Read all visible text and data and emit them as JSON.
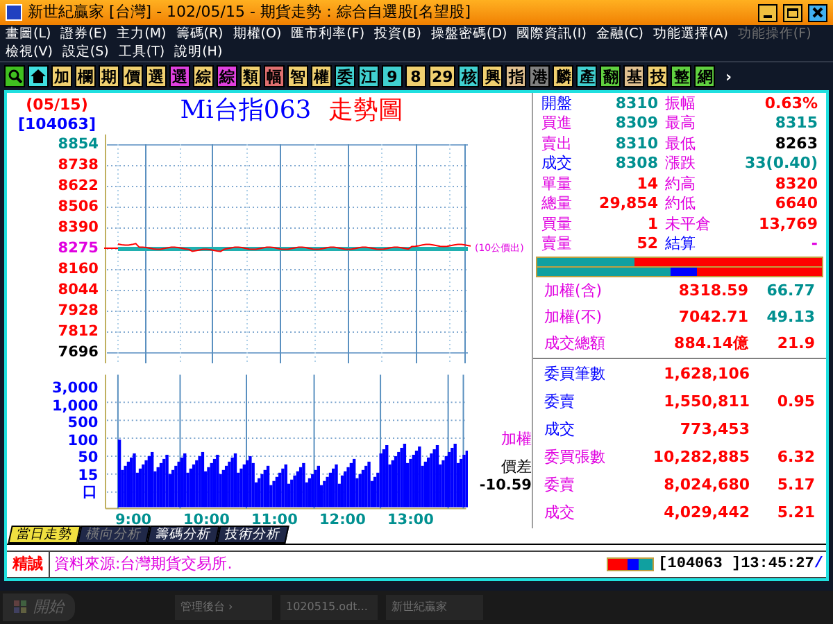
{
  "window": {
    "title": "新世紀贏家 [台灣]  - 102/05/15 - 期貨走勢：綜合自選股[名望股]"
  },
  "menu": [
    [
      {
        "label": "畫圖(L)",
        "disabled": false
      },
      {
        "label": "證券(E)",
        "disabled": false
      },
      {
        "label": "主力(M)",
        "disabled": false
      },
      {
        "label": "籌碼(R)",
        "disabled": false
      },
      {
        "label": "期權(O)",
        "disabled": false
      },
      {
        "label": "匯市利率(F)",
        "disabled": false
      },
      {
        "label": "投資(B)",
        "disabled": false
      },
      {
        "label": "操盤密碼(D)",
        "disabled": false
      },
      {
        "label": "國際資訊(I)",
        "disabled": false
      },
      {
        "label": "金融(C)",
        "disabled": false
      },
      {
        "label": "功能選擇(A)",
        "disabled": false
      },
      {
        "label": "功能操作(F)",
        "disabled": true
      }
    ],
    [
      {
        "label": "檢視(V)",
        "disabled": false
      },
      {
        "label": "設定(S)",
        "disabled": false
      },
      {
        "label": "工具(T)",
        "disabled": false
      },
      {
        "label": "說明(H)",
        "disabled": false
      }
    ]
  ],
  "toolbar": [
    {
      "kind": "search",
      "color": "#40c020"
    },
    {
      "kind": "home",
      "color": "#40e0e0"
    },
    {
      "kind": "text",
      "label": "加",
      "color": "#f0d070"
    },
    {
      "kind": "text",
      "label": "欄",
      "color": "#f0d070"
    },
    {
      "kind": "text",
      "label": "期",
      "color": "#f0d070"
    },
    {
      "kind": "text",
      "label": "價",
      "color": "#f0d070"
    },
    {
      "kind": "text",
      "label": "選",
      "color": "#f0d070"
    },
    {
      "kind": "text",
      "label": "選",
      "color": "#e040e0"
    },
    {
      "kind": "text",
      "label": "綜",
      "color": "#f0d070"
    },
    {
      "kind": "text",
      "label": "綜",
      "color": "#e040e0"
    },
    {
      "kind": "text",
      "label": "類",
      "color": "#f0d070"
    },
    {
      "kind": "text",
      "label": "幅",
      "color": "#e07070"
    },
    {
      "kind": "text",
      "label": "智",
      "color": "#f0d070"
    },
    {
      "kind": "text",
      "label": "權",
      "color": "#f0d070"
    },
    {
      "kind": "text",
      "label": "委",
      "color": "#40d0d0"
    },
    {
      "kind": "text",
      "label": "江",
      "color": "#40d0d0"
    },
    {
      "kind": "text",
      "label": "9",
      "color": "#40d0d0"
    },
    {
      "kind": "text",
      "label": "8",
      "color": "#f0d070"
    },
    {
      "kind": "text",
      "label": "29",
      "color": "#f0d070"
    },
    {
      "kind": "text",
      "label": "核",
      "color": "#40d0d0"
    },
    {
      "kind": "text",
      "label": "興",
      "color": "#f0d070"
    },
    {
      "kind": "text",
      "label": "指",
      "color": "#e0c090"
    },
    {
      "kind": "text",
      "label": "港",
      "color": "#808080"
    },
    {
      "kind": "text",
      "label": "麟",
      "color": "#f0d070"
    },
    {
      "kind": "text",
      "label": "產",
      "color": "#40d0d0"
    },
    {
      "kind": "text",
      "label": "翻",
      "color": "#60d040"
    },
    {
      "kind": "text",
      "label": "基",
      "color": "#e0c090"
    },
    {
      "kind": "text",
      "label": "技",
      "color": "#f0d070"
    },
    {
      "kind": "text",
      "label": "整",
      "color": "#60d040"
    },
    {
      "kind": "text",
      "label": "網",
      "color": "#60d040"
    },
    {
      "kind": "text",
      "label": "›",
      "color": "#101828"
    }
  ],
  "chart": {
    "date": "(05/15)",
    "code": "[104063]",
    "title": "Mi台指063",
    "title_suffix": "走勢圖",
    "price_ticks": [
      {
        "label": "8854",
        "color": "#009090"
      },
      {
        "label": "8738",
        "color": "#ff0000"
      },
      {
        "label": "8622",
        "color": "#ff0000"
      },
      {
        "label": "8506",
        "color": "#ff0000"
      },
      {
        "label": "8390",
        "color": "#ff0000"
      },
      {
        "label": "8275",
        "color": "#e000e0"
      },
      {
        "label": "8160",
        "color": "#ff0000"
      },
      {
        "label": "8044",
        "color": "#ff0000"
      },
      {
        "label": "7928",
        "color": "#ff0000"
      },
      {
        "label": "7812",
        "color": "#ff0000"
      },
      {
        "label": "7696",
        "color": "#000000"
      }
    ],
    "reference_note": "(10公價出)",
    "volume_ticks": [
      "3,000",
      "1,000",
      "500",
      "100",
      "50",
      "15",
      "口"
    ],
    "time_labels": [
      "9:00",
      "10:00",
      "11:00",
      "12:00",
      "13:00"
    ],
    "side_label": "加權",
    "spread_label": "價差",
    "spread_value": "-10.59"
  },
  "quote": [
    [
      {
        "text": "開盤",
        "color": "#0000ff"
      },
      {
        "text": "8310",
        "color": "#009090"
      },
      {
        "text": "振幅",
        "color": "#e000e0"
      },
      {
        "text": "0.63%",
        "color": "#ff0000"
      }
    ],
    [
      {
        "text": "買進",
        "color": "#e000e0"
      },
      {
        "text": "8309",
        "color": "#009090"
      },
      {
        "text": "最高",
        "color": "#e000e0"
      },
      {
        "text": "8315",
        "color": "#009090"
      }
    ],
    [
      {
        "text": "賣出",
        "color": "#e000e0"
      },
      {
        "text": "8310",
        "color": "#009090"
      },
      {
        "text": "最低",
        "color": "#e000e0"
      },
      {
        "text": "8263",
        "color": "#000000"
      }
    ],
    [
      {
        "text": "成交",
        "color": "#0000ff"
      },
      {
        "text": "8308",
        "color": "#009090"
      },
      {
        "text": "漲跌",
        "color": "#e000e0"
      },
      {
        "text": "33(0.40)",
        "color": "#009090"
      }
    ],
    [
      {
        "text": "單量",
        "color": "#e000e0"
      },
      {
        "text": "14",
        "color": "#ff0000"
      },
      {
        "text": "約高",
        "color": "#e000e0"
      },
      {
        "text": "8320",
        "color": "#ff0000"
      }
    ],
    [
      {
        "text": "總量",
        "color": "#e000e0"
      },
      {
        "text": "29,854",
        "color": "#ff0000"
      },
      {
        "text": "約低",
        "color": "#e000e0"
      },
      {
        "text": "6640",
        "color": "#ff0000"
      }
    ],
    [
      {
        "text": "買量",
        "color": "#e000e0"
      },
      {
        "text": "1",
        "color": "#ff0000"
      },
      {
        "text": "未平倉",
        "color": "#e000e0"
      },
      {
        "text": "13,769",
        "color": "#ff0000"
      }
    ],
    [
      {
        "text": "賣量",
        "color": "#e000e0"
      },
      {
        "text": "52",
        "color": "#ff0000"
      },
      {
        "text": "結算",
        "color": "#0000ff"
      },
      {
        "text": "-",
        "color": "#e000e0"
      }
    ]
  ],
  "index": [
    {
      "label": "加權(含)",
      "value": "8318.59",
      "change": "66.77"
    },
    {
      "label": "加權(不)",
      "value": "7042.71",
      "change": "49.13"
    },
    {
      "label": "成交總額",
      "value": "884.14億",
      "change": "21.9"
    }
  ],
  "orders": [
    {
      "label": "委買筆數",
      "color": "#0000ff",
      "value": "1,628,106"
    },
    {
      "label": "委賣",
      "color": "#0000ff",
      "value": "1,550,811",
      "ratio": "0.95"
    },
    {
      "label": "成交",
      "color": "#0000ff",
      "value": "773,453"
    },
    {
      "label": "委買張數",
      "color": "#e000e0",
      "value": "10,282,885",
      "ratio": "6.32"
    },
    {
      "label": "委賣",
      "color": "#e000e0",
      "value": "8,024,680",
      "ratio": "5.17"
    },
    {
      "label": "成交",
      "color": "#e000e0",
      "value": "4,029,442",
      "ratio": "5.21"
    }
  ],
  "tabs": [
    {
      "label": "當日走勢",
      "selected": true,
      "disabled": false
    },
    {
      "label": "橫向分析",
      "selected": false,
      "disabled": true
    },
    {
      "label": "籌碼分析",
      "selected": false,
      "disabled": false
    },
    {
      "label": "技術分析",
      "selected": false,
      "disabled": false
    }
  ],
  "status": {
    "source_label": "精誠",
    "message": "資料來源:台灣期貨交易所.",
    "code": "[104063 ]",
    "time": "13:45:27",
    "separator": "/"
  },
  "taskbar": {
    "start": "開始",
    "items": [
      "管理後台 ›",
      "1020515.odt...",
      "新世紀贏家"
    ]
  }
}
